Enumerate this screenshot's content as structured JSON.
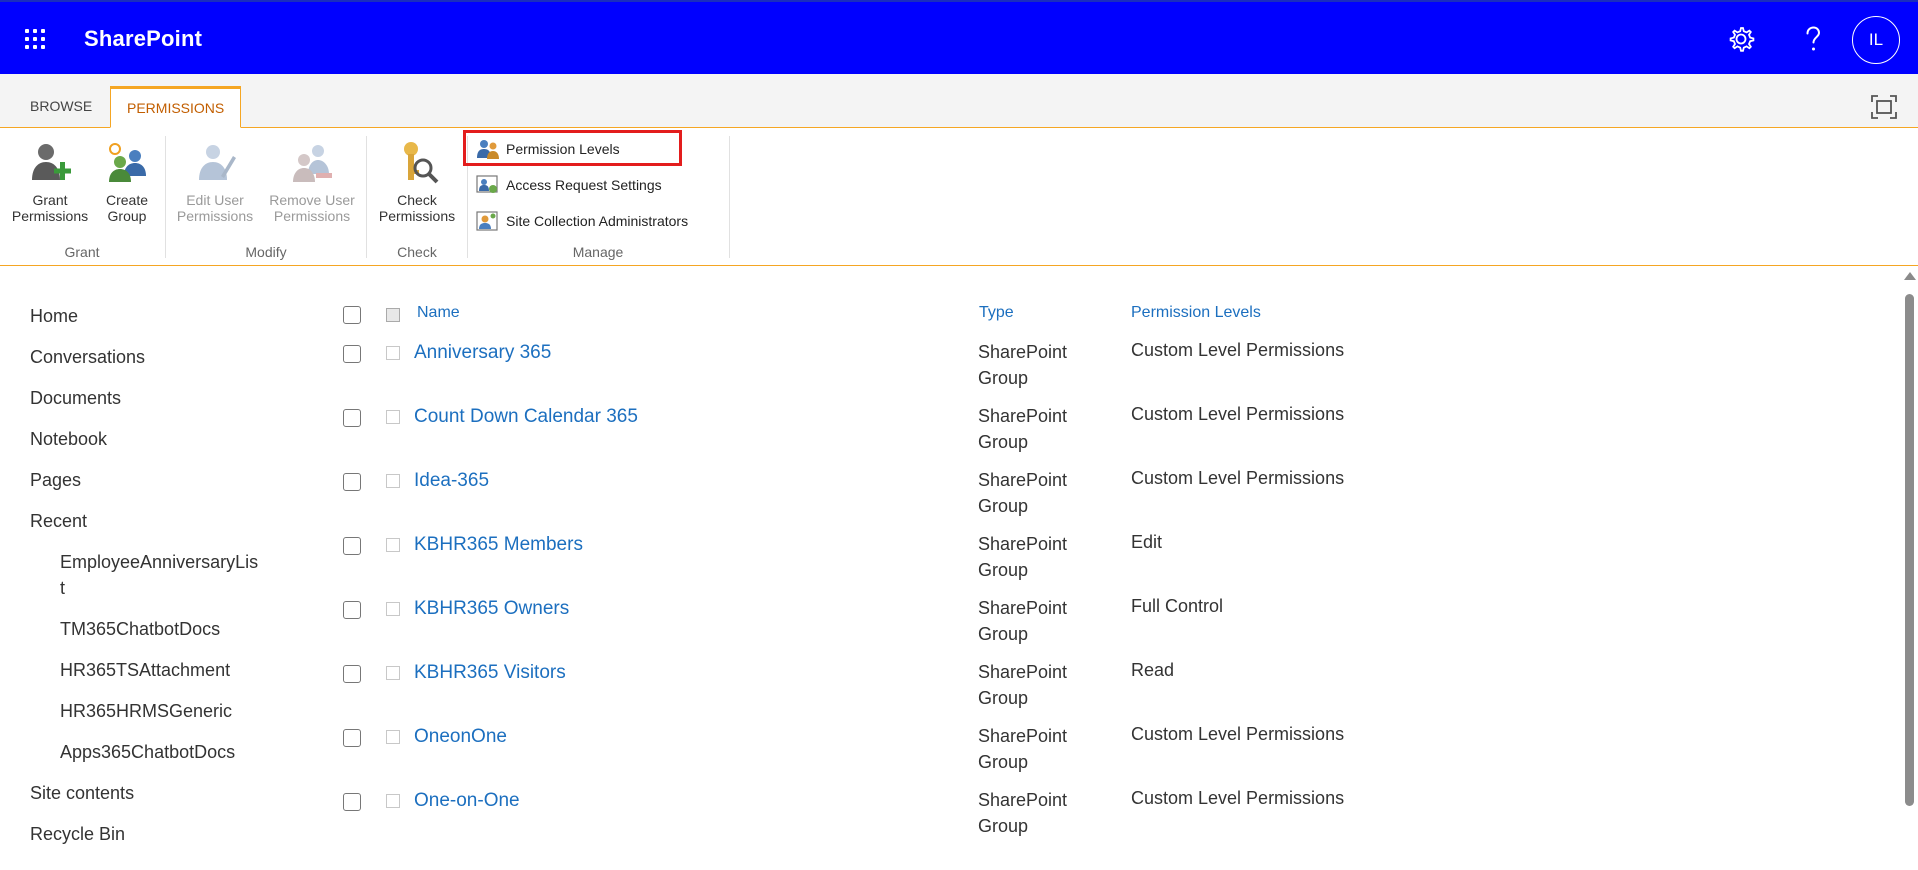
{
  "suite_bar": {
    "app_title": "SharePoint",
    "avatar_initials": "IL",
    "background_color": "#0000ff"
  },
  "ribbon_tabs": [
    {
      "label": "BROWSE",
      "active": false
    },
    {
      "label": "PERMISSIONS",
      "active": true
    }
  ],
  "ribbon": {
    "grant_permissions": [
      "Grant",
      "Permissions"
    ],
    "create_group": [
      "Create",
      "Group"
    ],
    "edit_user_permissions": [
      "Edit User",
      "Permissions"
    ],
    "remove_user_permissions": [
      "Remove User",
      "Permissions"
    ],
    "check_permissions": [
      "Check",
      "Permissions"
    ],
    "permission_levels": "Permission Levels",
    "access_request_settings": "Access Request Settings",
    "site_collection_administrators": "Site Collection Administrators",
    "groups": {
      "grant": "Grant",
      "modify": "Modify",
      "check": "Check",
      "manage": "Manage"
    }
  },
  "left_nav": {
    "items": [
      "Home",
      "Conversations",
      "Documents",
      "Notebook",
      "Pages",
      "Recent"
    ],
    "recent": [
      "EmployeeAnniversaryLis",
      "t",
      "TM365ChatbotDocs",
      "HR365TSAttachment",
      "HR365HRMSGeneric",
      "Apps365ChatbotDocs"
    ],
    "bottom": [
      "Site contents",
      "Recycle Bin"
    ]
  },
  "table": {
    "columns": {
      "name": "Name",
      "type": "Type",
      "permission_levels": "Permission Levels"
    },
    "rows": [
      {
        "name": "Anniversary 365",
        "type": [
          "SharePoint",
          "Group"
        ],
        "permission": "Custom Level Permissions"
      },
      {
        "name": "Count Down Calendar 365",
        "type": [
          "SharePoint",
          "Group"
        ],
        "permission": "Custom Level Permissions"
      },
      {
        "name": "Idea-365",
        "type": [
          "SharePoint",
          "Group"
        ],
        "permission": "Custom Level Permissions"
      },
      {
        "name": "KBHR365 Members",
        "type": [
          "SharePoint",
          "Group"
        ],
        "permission": "Edit"
      },
      {
        "name": "KBHR365 Owners",
        "type": [
          "SharePoint",
          "Group"
        ],
        "permission": "Full Control"
      },
      {
        "name": "KBHR365 Visitors",
        "type": [
          "SharePoint",
          "Group"
        ],
        "permission": "Read"
      },
      {
        "name": "OneonOne",
        "type": [
          "SharePoint",
          "Group"
        ],
        "permission": "Custom Level Permissions"
      },
      {
        "name": "One-on-One",
        "type": [
          "SharePoint",
          "Group"
        ],
        "permission": "Custom Level Permissions"
      }
    ]
  },
  "icons": {
    "waffle": "app-launcher-icon",
    "settings": "gear-icon",
    "help": "question-icon",
    "focus": "focus-mode-icon"
  }
}
